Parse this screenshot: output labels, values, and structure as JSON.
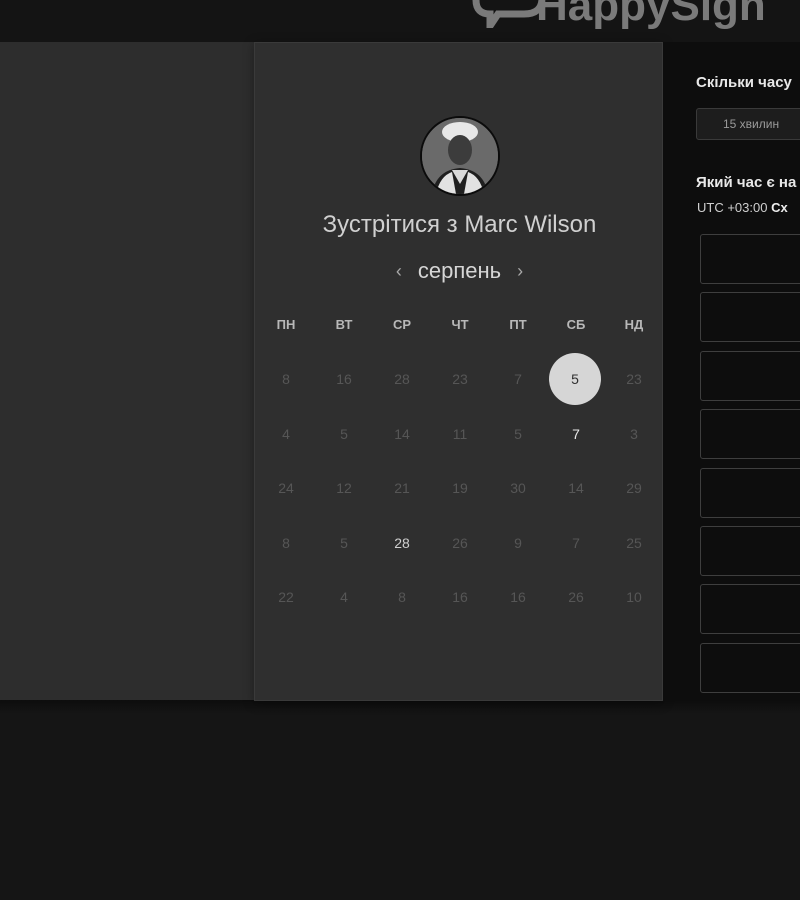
{
  "logo": {
    "text": "HappySign",
    "icon": "speech-bubble-logo-icon"
  },
  "booking": {
    "title_prefix": "Зустрітися з ",
    "host_name": "Marc Wilson",
    "month": "серпень",
    "prev_icon": "chevron-left-icon",
    "next_icon": "chevron-right-icon",
    "weekdays": [
      "ПН",
      "ВТ",
      "СР",
      "ЧТ",
      "ПТ",
      "СБ",
      "НД"
    ],
    "weeks": [
      [
        "8",
        "16",
        "28",
        "23",
        "7",
        "5",
        "23"
      ],
      [
        "4",
        "5",
        "14",
        "11",
        "5",
        "7",
        "3"
      ],
      [
        "24",
        "12",
        "21",
        "19",
        "30",
        "14",
        "29"
      ],
      [
        "8",
        "5",
        "28",
        "26",
        "9",
        "7",
        "25"
      ],
      [
        "22",
        "4",
        "8",
        "16",
        "16",
        "26",
        "10"
      ]
    ],
    "selected_day": "5"
  },
  "schedule": {
    "duration_question": "Скільки часу",
    "duration_option": "15 хвилин",
    "time_question": "Який час є на",
    "timezone_prefix": "UTC +03:00",
    "timezone_name": "Сх",
    "slots_visible": 8
  }
}
